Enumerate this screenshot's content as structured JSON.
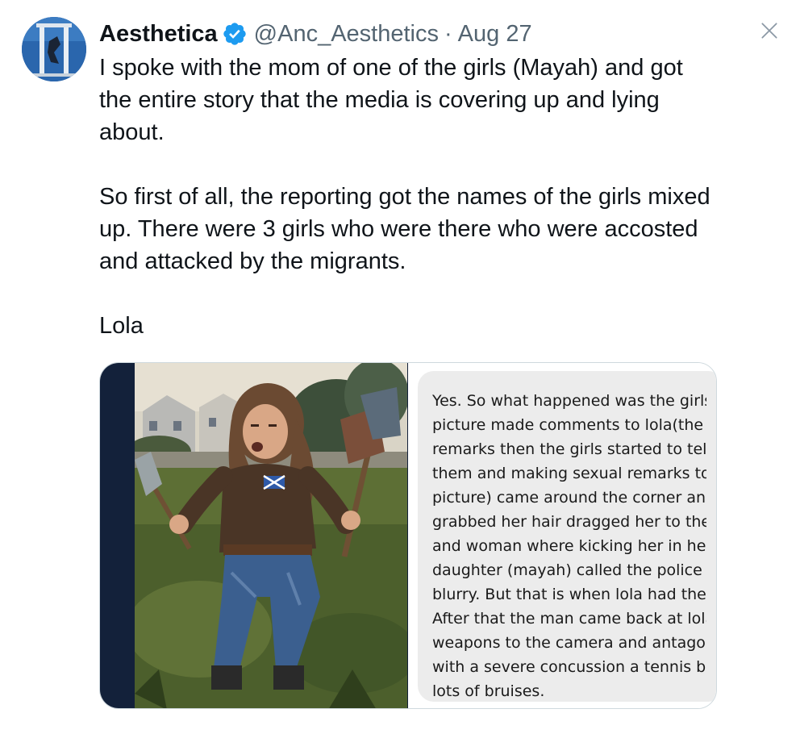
{
  "tweet": {
    "display_name": "Aesthetica",
    "handle": "@Anc_Aesthetics",
    "separator": "·",
    "date": "Aug 27",
    "avatar_icon": "avatar-image",
    "verified_icon": "verified-badge-icon",
    "paragraphs": [
      "I spoke with the mom of one of the girls (Mayah) and got the entire story that the media is covering up and lying about.",
      "So first of all, the reporting got the names of the girls mixed up. There were 3 girls who were there who were accosted and attacked by the migrants.",
      "Lola"
    ]
  },
  "media": {
    "image_description_icon": "girl-with-axes-illustration",
    "message_lines": [
      "Yes. So what happened was the girls",
      "picture made comments to lola(the",
      "remarks then the girls started to tell",
      "them and making sexual remarks to",
      "picture) came around the corner an",
      "grabbed her hair dragged her to the",
      "and woman where kicking her in he",
      "daughter (mayah) called the police",
      "blurry.  But that is when lola had the",
      "After that the man came back at lola",
      "weapons to the camera and antago",
      "with a severe concussion a tennis ba",
      "lots of bruises."
    ]
  },
  "colors": {
    "text_primary": "#0f1419",
    "text_secondary": "#536471",
    "verified_blue": "#1d9bf0",
    "bubble_gray": "#ececec",
    "media_border": "#cfd9de"
  },
  "icons": {
    "close": "close-icon"
  }
}
